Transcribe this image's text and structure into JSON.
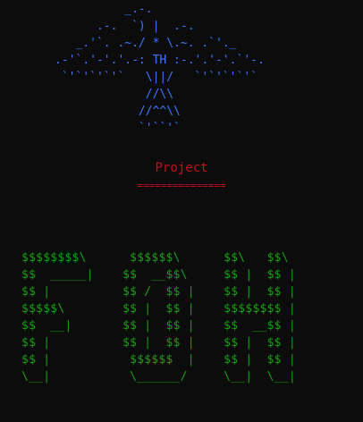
{
  "colors": {
    "background": "#0c0c0c",
    "bird": "#3b78ff",
    "title": "#c50f1f",
    "banner": "#13a10e"
  },
  "bird_art": "          _.-.\n      .-.  `) |  .-.\n   _.'`. .~./ * \\.~. .`'._\n.-'`.'-'.'.-: TH :-.'.'-'.`'-.\n `'`'`'`'`   \\||/   `'`'`'`'`\n             //\\\\\n            //^^\\\\\n            `'``'`",
  "project": {
    "title": "Project",
    "underline": "==============="
  },
  "banner_art": "$$$$$$$$\\      $$$$$$\\      $$\\   $$\\\n$$  _____|    $$  __$$\\     $$ |  $$ |\n$$ |          $$ /  $$ |    $$ |  $$ |\n$$$$$\\        $$ |  $$ |    $$$$$$$$ |\n$$  __|       $$ |  $$ |    $$  __$$ |\n$$ |          $$ |  $$ |    $$ |  $$ |\n$$ |           $$$$$$  |    $$ |  $$ |\n\\__|           \\______/     \\__|  \\__|"
}
